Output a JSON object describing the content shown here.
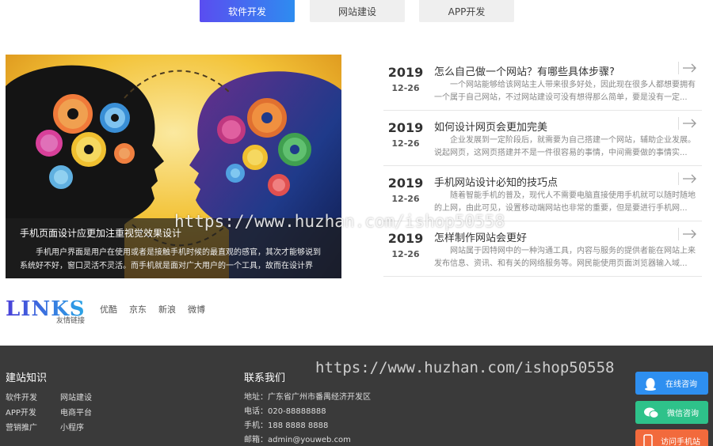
{
  "tabs": [
    {
      "label": "软件开发"
    },
    {
      "label": "网站建设"
    },
    {
      "label": "APP开发"
    }
  ],
  "feature": {
    "title": "手机页面设计应更加注重视觉效果设计",
    "description": "手机用户界面是用户在使用或者是接触手机时候的最直观的感官，其次才能够说到系统好不好，窗口灵活不灵活。而手机就是面对广大用户的一个工具，故而在设计界"
  },
  "news": [
    {
      "year": "2019",
      "md": "12-26",
      "title": "怎么自己做一个网站？有哪些具体步骤?",
      "excerpt": "一个网站能够给该网站主人带来很多好处，因此现在很多人都想要拥有一个属于自己网站，不过网站建设可没有想得那么简单，要是没有一定..."
    },
    {
      "year": "2019",
      "md": "12-26",
      "title": "如何设计网页会更加完美",
      "excerpt": "企业发展到一定阶段后，就需要为自己搭建一个网站，辅助企业发展。说起网页，这网页搭建并不是一件很容易的事情，中间需要做的事情实..."
    },
    {
      "year": "2019",
      "md": "12-26",
      "title": "手机网站设计必知的技巧点",
      "excerpt": "随着智能手机的普及，现代人不需要电脑直接使用手机就可以随时随地的上网，由此可见，设置移动端网站也非常的重要，但是要进行手机网..."
    },
    {
      "year": "2019",
      "md": "12-26",
      "title": "怎样制作网站会更好",
      "excerpt": "网站属于因特网中的一种沟通工具，内容与服务的提供者能在网站上来发布信息、资讯、和有关的网络服务等。网民能使用页面浏览器输入域..."
    }
  ],
  "links": {
    "logo_word": "LINKS",
    "logo_sub": "友情链接",
    "items": [
      "优酷",
      "京东",
      "新浪",
      "微博"
    ]
  },
  "footer": {
    "knowledge_title": "建站知识",
    "knowledge_items": [
      "软件开发",
      "网站建设",
      "APP开发",
      "电商平台",
      "营销推广",
      "小程序"
    ],
    "contact_title": "联系我们",
    "address": "地址：广东省广州市番禺经济开发区",
    "phone": "电话：020-88888888",
    "mobile": "手机：188 8888 8888",
    "email": "邮箱：admin@youweb.com"
  },
  "side_buttons": {
    "online": "在线咨询",
    "wechat": "微信咨询",
    "mobile": "访问手机站"
  },
  "watermarks": {
    "main": "https://www.huzhan.com/ishop50558",
    "footer": "https://www.huzhan.com/ishop50558"
  },
  "colors": {
    "accent": "#2e8cf0",
    "footer_bg": "#3a3a3a",
    "wechat_green": "#2ec28a",
    "mobile_orange": "#f26a3c"
  }
}
